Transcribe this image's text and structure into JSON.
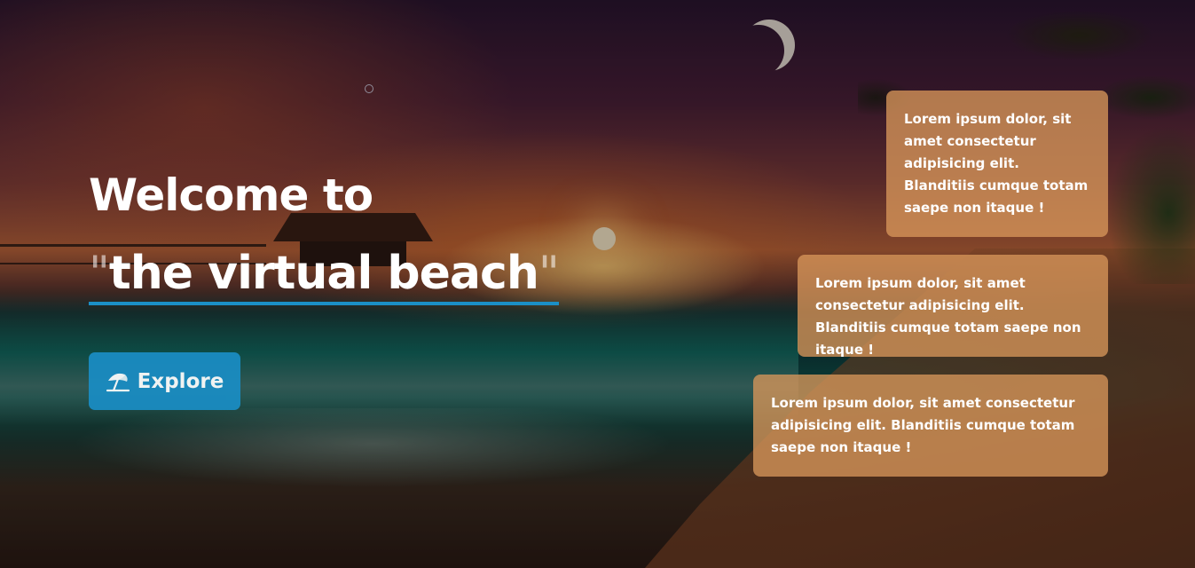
{
  "hero": {
    "line1": "Welcome to",
    "open_quote": "\"",
    "line2": "the virtual beach",
    "close_quote": "\""
  },
  "explore_button": {
    "label": "Explore",
    "icon": "beach-umbrella-icon"
  },
  "cards": [
    {
      "text": "Lorem ipsum dolor, sit amet consectetur adipisicing elit. Blanditiis cumque totam saepe non itaque !"
    },
    {
      "text": "Lorem ipsum dolor, sit amet consectetur adipisicing elit. Blanditiis cumque totam saepe non itaque !"
    },
    {
      "text": "Lorem ipsum dolor, sit amet consectetur adipisicing elit. Blanditiis cumque totam saepe non itaque !"
    }
  ],
  "colors": {
    "accent": "#1a8dc4",
    "card_background": "#d7965a",
    "text": "#ffffff"
  }
}
